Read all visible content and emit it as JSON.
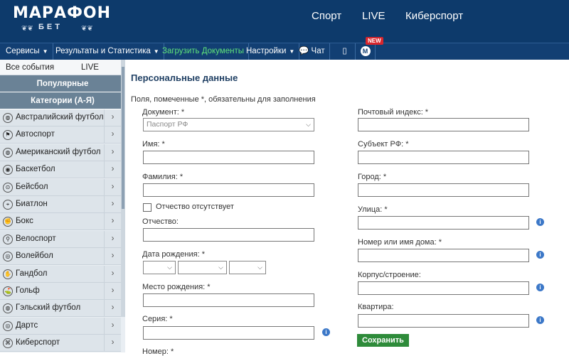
{
  "brand": {
    "name": "МАРАФОН",
    "sub": "БЕТ"
  },
  "topnav": [
    "Спорт",
    "LIVE",
    "Киберспорт"
  ],
  "menu": {
    "services": "Сервисы",
    "results": "Результаты и Статистика",
    "upload": "Загрузить Документы",
    "settings": "Настройки",
    "chat": "Чат",
    "new_badge": "NEW"
  },
  "sidebar": {
    "tab_all": "Все события",
    "tab_live": "LIVE",
    "popular": "Популярные",
    "categories": "Категории (А-Я)",
    "items": [
      "Австралийский футбол",
      "Автоспорт",
      "Американский футбол",
      "Баскетбол",
      "Бейсбол",
      "Биатлон",
      "Бокс",
      "Велоспорт",
      "Волейбол",
      "Гандбол",
      "Гольф",
      "Гэльский футбол",
      "Дартс",
      "Киберспорт"
    ]
  },
  "form": {
    "title": "Персональные данные",
    "required_note": "Поля, помеченные *, обязательны для заполнения",
    "document_label": "Документ: *",
    "document_value": "Паспорт РФ",
    "name_label": "Имя: *",
    "surname_label": "Фамилия: *",
    "no_patronymic": "Отчество отсутствует",
    "patronymic_label": "Отчество:",
    "birthdate_label": "Дата рождения: *",
    "birthplace_label": "Место рождения: *",
    "series_label": "Серия: *",
    "number_label": "Номер: *",
    "postal_label": "Почтовый индекс: *",
    "region_label": "Субъект РФ: *",
    "city_label": "Город: *",
    "street_label": "Улица: *",
    "house_label": "Номер или имя дома: *",
    "building_label": "Корпус/строение:",
    "apartment_label": "Квартира:",
    "save": "Сохранить"
  }
}
